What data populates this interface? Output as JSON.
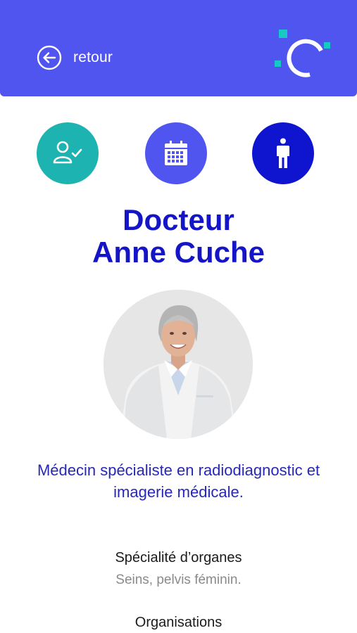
{
  "header": {
    "back_label": "retour",
    "colors": {
      "background": "#5155f0",
      "logo_accent": "#18c8c4"
    }
  },
  "actions": [
    {
      "name": "verified-user",
      "icon": "user-check-icon",
      "color": "#1cb3b0"
    },
    {
      "name": "calendar",
      "icon": "calendar-icon",
      "color": "#5155f0"
    },
    {
      "name": "body",
      "icon": "person-standing-icon",
      "color": "#0f14cf"
    }
  ],
  "doctor": {
    "title_line1": "Docteur",
    "title_line2": "Anne Cuche",
    "photo": "doctor-portrait",
    "description": "Médecin spécialiste en radiodiagnostic et imagerie médicale."
  },
  "sections": {
    "organ_specialty_label": "Spécialité d’organes",
    "organ_specialty_value": "Seins, pelvis féminin.",
    "organisations_label": "Organisations"
  }
}
